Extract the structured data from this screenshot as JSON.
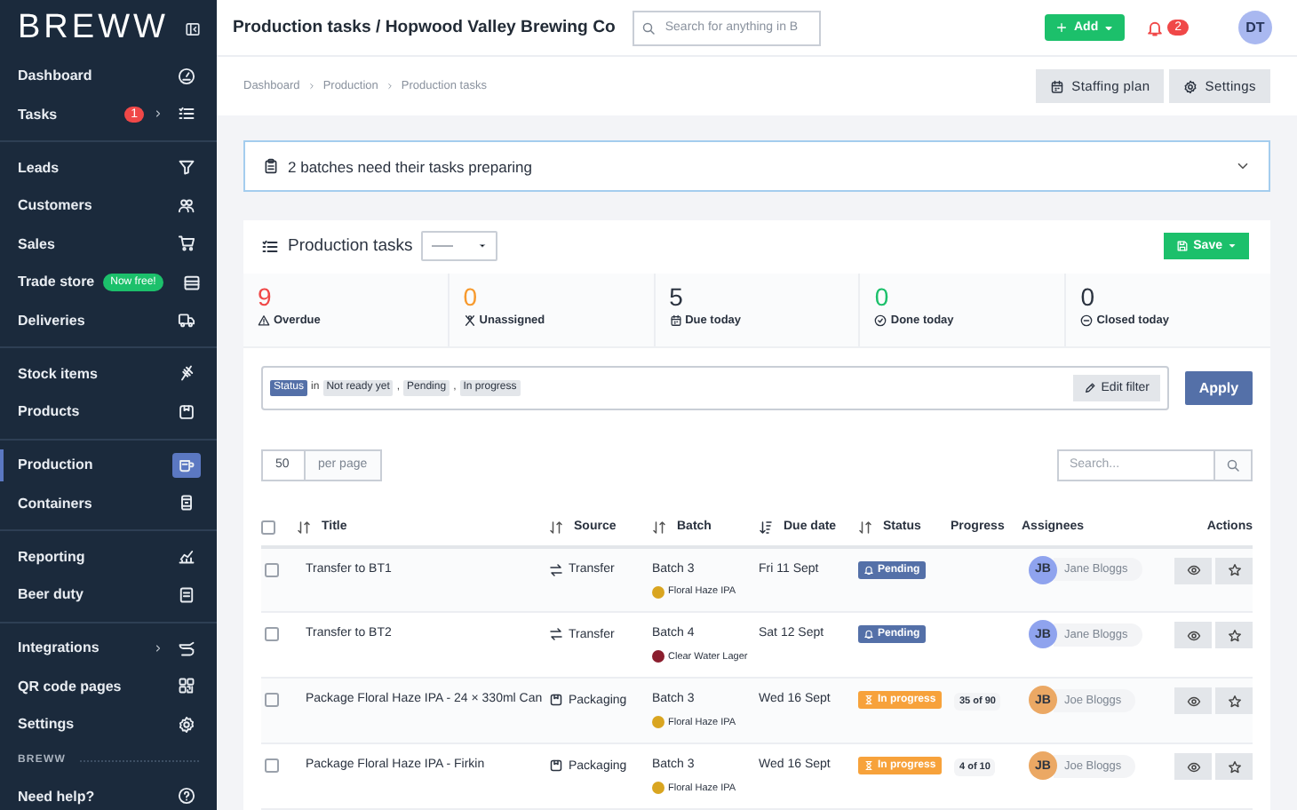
{
  "sidebar": {
    "logo": "BREWW",
    "groups": [
      {
        "items": [
          {
            "label": "Dashboard",
            "selected": false,
            "has_submenu": false
          },
          {
            "label": "Tasks",
            "selected": false,
            "has_submenu": true,
            "badge": "1"
          }
        ]
      },
      {
        "items": [
          {
            "label": "Leads",
            "selected": false,
            "has_submenu": false
          },
          {
            "label": "Customers",
            "selected": false,
            "has_submenu": false
          },
          {
            "label": "Sales",
            "selected": false,
            "has_submenu": false
          },
          {
            "label": "Trade store",
            "selected": false,
            "has_submenu": false,
            "tag": "Now free!"
          },
          {
            "label": "Deliveries",
            "selected": false,
            "has_submenu": false
          }
        ]
      },
      {
        "items": [
          {
            "label": "Stock items",
            "selected": false,
            "has_submenu": false
          },
          {
            "label": "Products",
            "selected": false,
            "has_submenu": false
          }
        ]
      },
      {
        "items": [
          {
            "label": "Production",
            "selected": true,
            "has_submenu": false
          },
          {
            "label": "Containers",
            "selected": false,
            "has_submenu": false
          }
        ]
      },
      {
        "items": [
          {
            "label": "Reporting",
            "selected": false,
            "has_submenu": false
          },
          {
            "label": "Beer duty",
            "selected": false,
            "has_submenu": false
          }
        ]
      },
      {
        "items": [
          {
            "label": "Integrations",
            "selected": false,
            "has_submenu": true
          },
          {
            "label": "QR code pages",
            "selected": false,
            "has_submenu": false
          },
          {
            "label": "Settings",
            "selected": false,
            "has_submenu": false
          }
        ]
      }
    ],
    "section_label": "BREWW",
    "footer_item": "Need help?"
  },
  "header": {
    "title": "Production tasks / Hopwood Valley Brewing Co",
    "search": {
      "placeholder": "Search for anything in B"
    },
    "add_button": "Add",
    "notifications": "2",
    "avatar": "DT"
  },
  "toolbar": {
    "breadcrumbs": [
      "Dashboard",
      "Production",
      "Production tasks"
    ],
    "buttons": [
      "Staffing plan",
      "Settings"
    ]
  },
  "alert": {
    "text": "2 batches need their tasks preparing"
  },
  "tasks": {
    "title": "Production tasks",
    "save_button": "Save",
    "stats": [
      {
        "kind": "overdue",
        "value": "9",
        "label": "Overdue",
        "color": "#f04848"
      },
      {
        "kind": "unassigned",
        "value": "0",
        "label": "Unassigned",
        "color": "#f79a2e"
      },
      {
        "kind": "due",
        "value": "5",
        "label": "Due today",
        "color": "#2b3340"
      },
      {
        "kind": "done",
        "value": "0",
        "label": "Done today",
        "color": "#1cc06b"
      },
      {
        "kind": "closed",
        "value": "0",
        "label": "Closed today",
        "color": "#2b3340"
      }
    ],
    "filter": {
      "field": "Status",
      "operator": "in",
      "values": [
        "Not ready yet",
        "Pending",
        "In progress"
      ],
      "separator": ",",
      "edit_button": "Edit filter"
    },
    "apply_button": "Apply",
    "per_page": {
      "value": "50",
      "label": "per page"
    },
    "search": {
      "placeholder": "Search..."
    },
    "table": {
      "all_selected": false,
      "columns": [
        {
          "label": "Title",
          "sortable": true,
          "sorted_descending": false
        },
        {
          "label": "Source",
          "sortable": true,
          "sorted_descending": false
        },
        {
          "label": "Batch",
          "sortable": true,
          "sorted_descending": false
        },
        {
          "label": "Due date",
          "sortable": true,
          "sorted_descending": true
        },
        {
          "label": "Status",
          "sortable": true,
          "sorted_descending": false
        },
        {
          "label": "Progress",
          "sortable": false
        },
        {
          "label": "Assignees",
          "sortable": false
        },
        {
          "label": "Actions",
          "sortable": false
        }
      ],
      "rows": [
        {
          "selected": false,
          "title": "Transfer to BT1",
          "source": {
            "kind": "transfer",
            "label": "Transfer"
          },
          "batch": "Batch 3",
          "beer": {
            "name": "Floral Haze IPA",
            "color": "#d9a520"
          },
          "due": "Fri 11 Sept",
          "status": {
            "kind": "pending",
            "label": "Pending"
          },
          "assignee": {
            "initials": "JB",
            "name": "Jane Bloggs",
            "color": "#8fa3ee"
          }
        },
        {
          "selected": false,
          "title": "Transfer to BT2",
          "source": {
            "kind": "transfer",
            "label": "Transfer"
          },
          "batch": "Batch 4",
          "beer": {
            "name": "Clear Water Lager",
            "color": "#8b1e2e"
          },
          "due": "Sat 12 Sept",
          "status": {
            "kind": "pending",
            "label": "Pending"
          },
          "assignee": {
            "initials": "JB",
            "name": "Jane Bloggs",
            "color": "#8fa3ee"
          }
        },
        {
          "selected": false,
          "title": "Package Floral Haze IPA - 24 × 330ml Can",
          "source": {
            "kind": "packaging",
            "label": "Packaging"
          },
          "batch": "Batch 3",
          "beer": {
            "name": "Floral Haze IPA",
            "color": "#d9a520"
          },
          "due": "Wed 16 Sept",
          "status": {
            "kind": "in_progress",
            "label": "In progress"
          },
          "progress": "35 of 90",
          "assignee": {
            "initials": "JB",
            "name": "Joe Bloggs",
            "color": "#eba864"
          }
        },
        {
          "selected": false,
          "title": "Package Floral Haze IPA - Firkin",
          "source": {
            "kind": "packaging",
            "label": "Packaging"
          },
          "batch": "Batch 3",
          "beer": {
            "name": "Floral Haze IPA",
            "color": "#d9a520"
          },
          "due": "Wed 16 Sept",
          "status": {
            "kind": "in_progress",
            "label": "In progress"
          },
          "progress": "4 of 10",
          "assignee": {
            "initials": "JB",
            "name": "Joe Bloggs",
            "color": "#eba864"
          }
        }
      ]
    }
  }
}
